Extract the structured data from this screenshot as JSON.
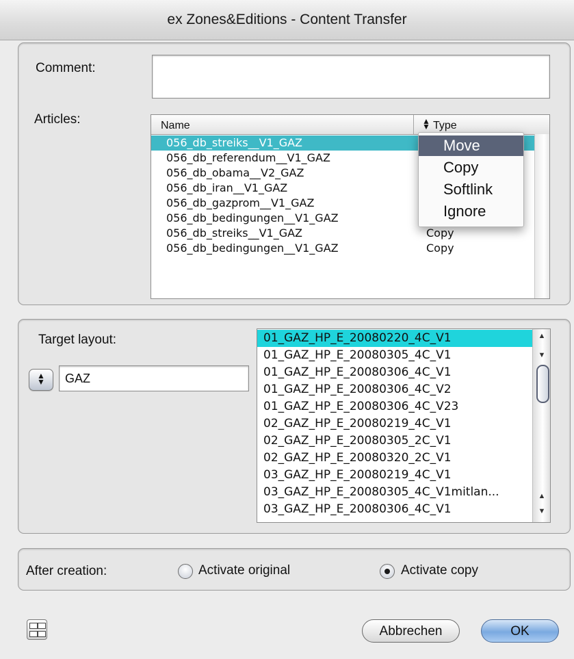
{
  "window": {
    "title": "ex Zones&Editions - Content Transfer"
  },
  "comment": {
    "label": "Comment:",
    "value": ""
  },
  "articles": {
    "label": "Articles:",
    "columns": {
      "name": "Name",
      "type": "Type"
    },
    "rows": [
      {
        "name": "056_db_streiks__V1_GAZ",
        "type": ""
      },
      {
        "name": "056_db_referendum__V1_GAZ",
        "type": ""
      },
      {
        "name": "056_db_obama__V2_GAZ",
        "type": ""
      },
      {
        "name": "056_db_iran__V1_GAZ",
        "type": ""
      },
      {
        "name": "056_db_gazprom__V1_GAZ",
        "type": ""
      },
      {
        "name": "056_db_bedingungen__V1_GAZ",
        "type": ""
      },
      {
        "name": "056_db_streiks__V1_GAZ",
        "type": "Copy"
      },
      {
        "name": "056_db_bedingungen__V1_GAZ",
        "type": "Copy"
      }
    ],
    "type_menu": {
      "highlighted": "Move",
      "options": [
        "Move",
        "Copy",
        "Softlink",
        "Ignore"
      ]
    }
  },
  "target": {
    "label": "Target layout:",
    "filter_value": "GAZ",
    "layouts": [
      "01_GAZ_HP_E_20080220_4C_V1",
      "01_GAZ_HP_E_20080305_4C_V1",
      "01_GAZ_HP_E_20080306_4C_V1",
      "01_GAZ_HP_E_20080306_4C_V2",
      "01_GAZ_HP_E_20080306_4C_V23",
      "02_GAZ_HP_E_20080219_4C_V1",
      "02_GAZ_HP_E_20080305_2C_V1",
      "02_GAZ_HP_E_20080320_2C_V1",
      "03_GAZ_HP_E_20080219_4C_V1",
      "03_GAZ_HP_E_20080305_4C_V1mitlan...",
      "03_GAZ_HP_E_20080306_4C_V1"
    ],
    "selected_index": 0
  },
  "after_creation": {
    "label": "After creation:",
    "options": [
      "Activate original",
      "Activate copy"
    ],
    "selected": "Activate copy"
  },
  "buttons": {
    "cancel": "Abbrechen",
    "ok": "OK"
  },
  "colors": {
    "selection_articles": "#3fb9c6",
    "selection_layouts": "#1fd4dc",
    "menu_highlight": "#5a6378",
    "default_button": "#7aa9e0"
  }
}
